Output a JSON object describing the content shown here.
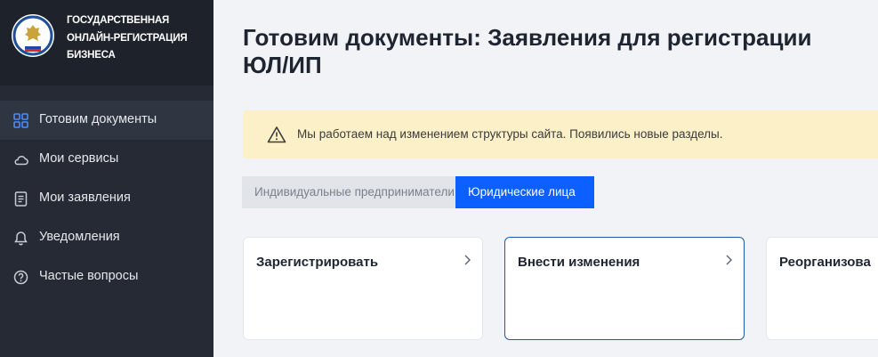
{
  "brand": {
    "line1": "ГОСУДАРСТВЕННАЯ",
    "line2": "ОНЛАЙН-РЕГИСТРАЦИЯ",
    "line3": "БИЗНЕСА"
  },
  "sidebar": {
    "items": [
      {
        "label": "Готовим документы",
        "icon": "grid-icon",
        "active": true
      },
      {
        "label": "Мои сервисы",
        "icon": "cloud-icon"
      },
      {
        "label": "Мои заявления",
        "icon": "document-icon"
      },
      {
        "label": "Уведомления",
        "icon": "bell-icon"
      },
      {
        "label": "Частые вопросы",
        "icon": "question-circle-icon"
      }
    ]
  },
  "main": {
    "title_line1": "Готовим документы: Заявления для регистрации",
    "title_line2": "ЮЛ/ИП",
    "notice": "Мы работаем над изменением структуры сайта. Появились новые разделы.",
    "tabs": [
      {
        "label": "Индивидуальные предприниматели",
        "active": false
      },
      {
        "label": "Юридические лица",
        "active": true
      }
    ],
    "cards": [
      {
        "title": "Зарегистрировать"
      },
      {
        "title": "Внести изменения"
      },
      {
        "title": "Реорганизова"
      }
    ]
  },
  "colors": {
    "sidebar_bg": "#252a34",
    "accent": "#0b60ff",
    "notice_bg": "#fcf0c8",
    "nav_icon": "#4f8cf7"
  }
}
